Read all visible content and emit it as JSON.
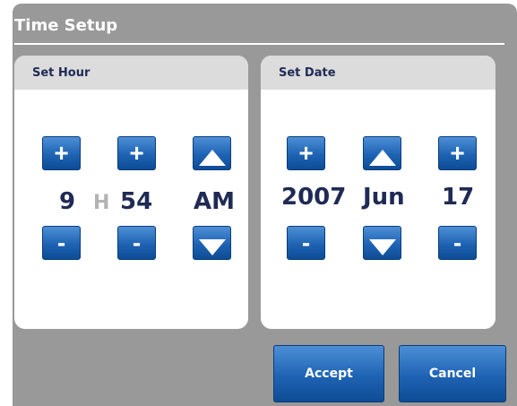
{
  "dialog": {
    "title": "Time Setup",
    "accept_label": "Accept",
    "cancel_label": "Cancel"
  },
  "hour_panel": {
    "header": "Set Hour",
    "hour": "9",
    "separator": "H",
    "minute": "54",
    "period": "AM",
    "plus_glyph": "+",
    "minus_glyph": "-"
  },
  "date_panel": {
    "header": "Set Date",
    "year": "2007",
    "month": "Jun",
    "day": "17",
    "plus_glyph": "+",
    "minus_glyph": "-"
  },
  "icons": {
    "up": "triangle-up-icon",
    "down": "triangle-down-icon"
  },
  "colors": {
    "button_gradient_top": "#4d8fd6",
    "button_gradient_bottom": "#0e4c95",
    "value_text": "#1f2a55",
    "dialog_background": "#999999"
  }
}
